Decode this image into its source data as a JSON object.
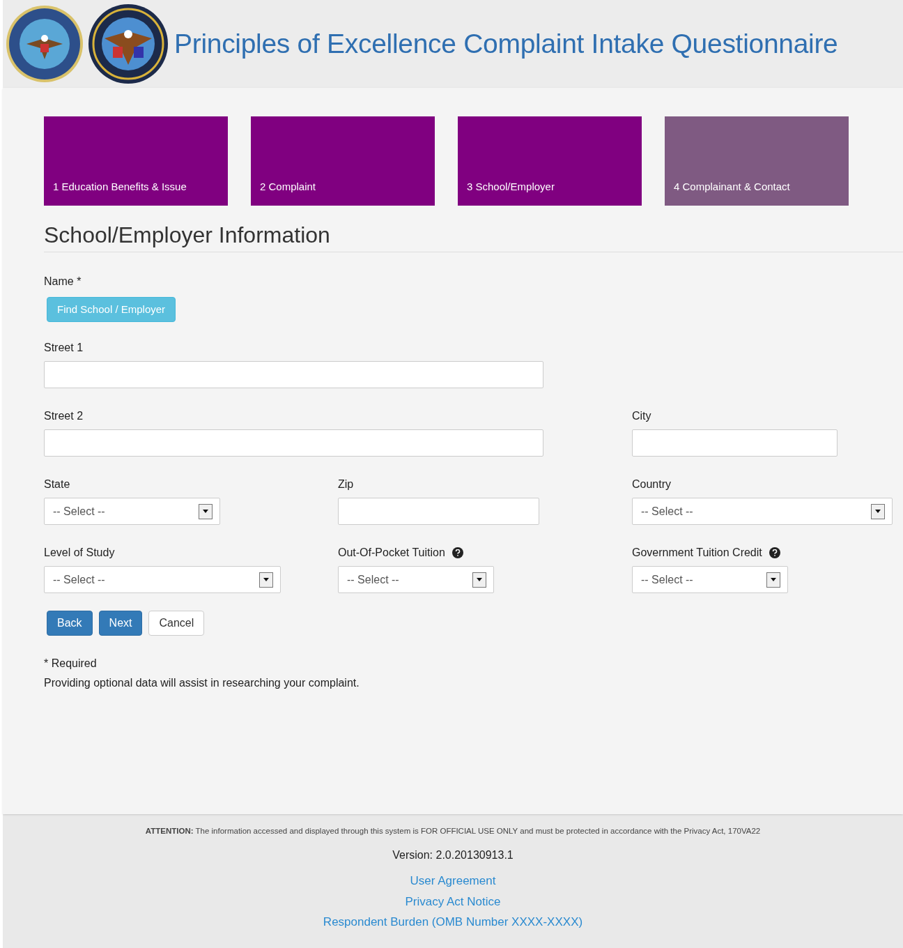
{
  "header": {
    "title": "Principles of Excellence Complaint Intake Questionnaire"
  },
  "steps": [
    {
      "label": "1 Education Benefits & Issue",
      "enabled": true
    },
    {
      "label": "2 Complaint",
      "enabled": true
    },
    {
      "label": "3 School/Employer",
      "enabled": true
    },
    {
      "label": "4 Complainant & Contact",
      "enabled": false
    }
  ],
  "section_title": "School/Employer Information",
  "name_field": {
    "label": "Name *",
    "button": "Find School / Employer"
  },
  "rows": [
    [
      {
        "kind": "text",
        "label": "Street 1"
      }
    ],
    [
      {
        "kind": "text",
        "label": "Street 2"
      },
      {
        "kind": "text",
        "label": "City"
      }
    ],
    [
      {
        "kind": "select",
        "label": "State",
        "value": "-- Select --"
      },
      {
        "kind": "text",
        "label": "Zip"
      },
      {
        "kind": "select",
        "label": "Country",
        "value": "-- Select --"
      }
    ],
    [
      {
        "kind": "select",
        "label": "Level of Study",
        "value": "-- Select --"
      },
      {
        "kind": "select",
        "label": "Out-Of-Pocket Tuition",
        "value": "-- Select --",
        "help": true
      },
      {
        "kind": "select",
        "label": "Government Tuition Credit",
        "value": "-- Select --",
        "help": true
      }
    ]
  ],
  "buttons": [
    {
      "label": "Back",
      "kind": "primary"
    },
    {
      "label": "Next",
      "kind": "primary"
    },
    {
      "label": "Cancel",
      "kind": "default"
    }
  ],
  "notes": [
    "* Required",
    "Providing optional data will assist in researching your complaint."
  ],
  "footer": {
    "attention": "**ATTENTION:** The information accessed and displayed through this system is FOR OFFICIAL USE ONLY and must be protected in accordance with the Privacy Act, 170VA22",
    "version": "Version: 2.0.20130913.1",
    "links": [
      "User Agreement",
      "Privacy Act Notice",
      "Respondent Burden (OMB Number XXXX-XXXX)"
    ]
  }
}
